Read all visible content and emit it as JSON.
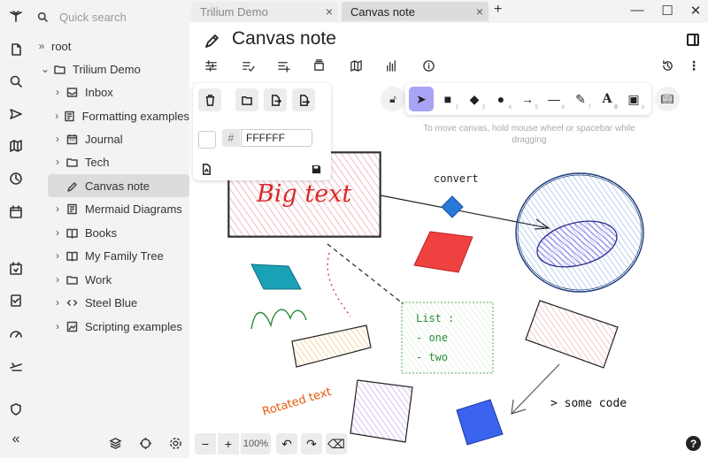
{
  "search": {
    "placeholder": "Quick search"
  },
  "tree": {
    "root": "root",
    "items": [
      {
        "label": "Trilium Demo",
        "icon": "folder-icon"
      },
      {
        "label": "Inbox",
        "icon": "inbox-icon"
      },
      {
        "label": "Formatting examples",
        "icon": "text-note-icon"
      },
      {
        "label": "Journal",
        "icon": "calendar-icon"
      },
      {
        "label": "Tech",
        "icon": "folder-icon"
      },
      {
        "label": "Canvas note",
        "icon": "pen-icon"
      },
      {
        "label": "Mermaid Diagrams",
        "icon": "text-note-icon"
      },
      {
        "label": "Books",
        "icon": "book-icon"
      },
      {
        "label": "My Family Tree",
        "icon": "book-icon"
      },
      {
        "label": "Work",
        "icon": "folder-icon"
      },
      {
        "label": "Steel Blue",
        "icon": "code-icon"
      },
      {
        "label": "Scripting examples",
        "icon": "image-icon"
      }
    ]
  },
  "tabs": [
    {
      "label": "Trilium Demo",
      "active": false
    },
    {
      "label": "Canvas note",
      "active": true
    }
  ],
  "note": {
    "title": "Canvas note"
  },
  "canvas": {
    "hint": "To move canvas, hold mouse wheel or spacebar while dragging",
    "color_hex": "FFFFFF",
    "hash": "#",
    "zoom": "100%",
    "texts": {
      "big": "Big text",
      "convert": "convert",
      "list": "List :",
      "one": "- one",
      "two": "- two",
      "rotated": "Rotated text",
      "code": "> some code"
    },
    "tools": [
      {
        "name": "selection-tool",
        "glyph": "➤",
        "key": "1"
      },
      {
        "name": "rectangle-tool",
        "glyph": "■",
        "key": "2"
      },
      {
        "name": "diamond-tool",
        "glyph": "◆",
        "key": "3"
      },
      {
        "name": "ellipse-tool",
        "glyph": "●",
        "key": "4"
      },
      {
        "name": "arrow-tool",
        "glyph": "→",
        "key": "5"
      },
      {
        "name": "line-tool",
        "glyph": "—",
        "key": "6"
      },
      {
        "name": "draw-tool",
        "glyph": "✎",
        "key": "7"
      },
      {
        "name": "text-tool",
        "glyph": "A",
        "key": "8"
      },
      {
        "name": "image-tool",
        "glyph": "▣",
        "key": "9"
      }
    ]
  },
  "colors": {
    "accent": "#a9a3f5",
    "big_text": "#d62828",
    "list_text": "#2b8a3e",
    "rotated_text": "#e8590c"
  }
}
